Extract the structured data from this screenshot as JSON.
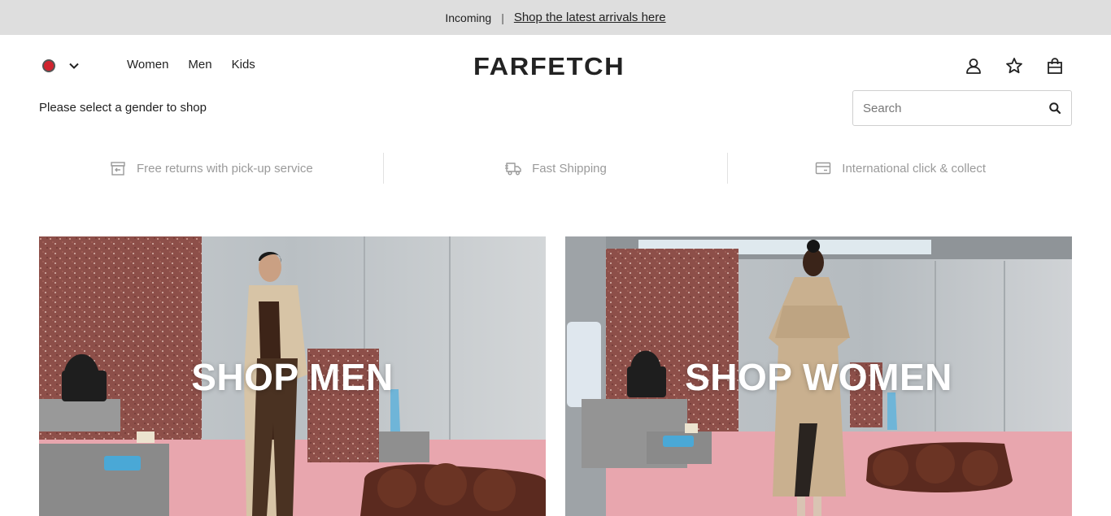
{
  "promo": {
    "label": "Incoming",
    "separator": "|",
    "link": "Shop the latest arrivals here"
  },
  "header": {
    "region_flag_color": "#d1242f",
    "nav": [
      "Women",
      "Men",
      "Kids"
    ],
    "logo": "FARFETCH",
    "utility_icons": [
      "account-icon",
      "wishlist-icon",
      "bag-icon"
    ]
  },
  "gender_prompt": "Please select a gender to shop",
  "search": {
    "placeholder": "Search"
  },
  "benefits": [
    {
      "label": "Free returns with pick-up service",
      "icon": "returns-box-icon"
    },
    {
      "label": "Fast Shipping",
      "icon": "delivery-truck-icon"
    },
    {
      "label": "International click & collect",
      "icon": "card-icon"
    }
  ],
  "tiles": {
    "men": {
      "label": "SHOP MEN"
    },
    "women": {
      "label": "SHOP WOMEN"
    }
  },
  "colors": {
    "promo_bg": "#dedede",
    "benefit_text": "#9a9a9a",
    "floor_pink": "#e9a9b1",
    "terrazzo": "#8a4a45"
  }
}
